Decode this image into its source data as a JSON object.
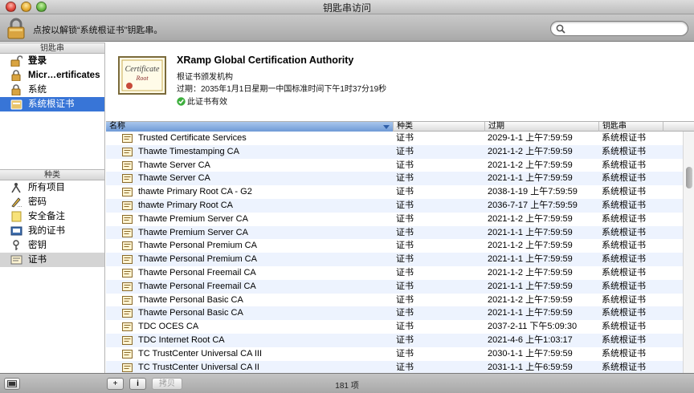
{
  "window": {
    "title": "钥匙串访问"
  },
  "toolbar": {
    "lock_hint": "点按以解锁“系统根证书”钥匙串。",
    "search": {
      "placeholder": "",
      "value": ""
    }
  },
  "sidebar": {
    "keychains_header": "钥匙串",
    "keychains": [
      {
        "label": "登录",
        "icon": "lock-open-icon",
        "bold": true
      },
      {
        "label": "Micr…ertificates",
        "icon": "lock-icon",
        "bold": true
      },
      {
        "label": "系统",
        "icon": "lock-icon",
        "bold": false
      },
      {
        "label": "系统根证书",
        "icon": "cabinet-icon",
        "bold": false,
        "selected": true
      }
    ],
    "category_header": "种类",
    "categories": [
      {
        "label": "所有项目",
        "icon": "all-items-icon"
      },
      {
        "label": "密码",
        "icon": "pencil-icon"
      },
      {
        "label": "安全备注",
        "icon": "note-icon"
      },
      {
        "label": "我的证书",
        "icon": "my-certificate-icon"
      },
      {
        "label": "密钥",
        "icon": "key-icon"
      },
      {
        "label": "证书",
        "icon": "certificate-icon",
        "selected": true
      }
    ]
  },
  "detail": {
    "name": "XRamp Global Certification Authority",
    "subtitle": "根证书颁发机构",
    "expiry": "过期：2035年1月1日星期一中国标准时间下午1时37分19秒",
    "valid": "此证书有效",
    "thumb_text": "Certificate",
    "thumb_root": "Root"
  },
  "table": {
    "columns": {
      "name": "名称",
      "kind": "种类",
      "expires": "过期",
      "keychain": "钥匙串"
    },
    "rows": [
      {
        "name": "Trusted Certificate Services",
        "kind": "证书",
        "expires": "2029-1-1 上午7:59:59",
        "keychain": "系统根证书"
      },
      {
        "name": "Thawte Timestamping CA",
        "kind": "证书",
        "expires": "2021-1-2 上午7:59:59",
        "keychain": "系统根证书"
      },
      {
        "name": "Thawte Server CA",
        "kind": "证书",
        "expires": "2021-1-2 上午7:59:59",
        "keychain": "系统根证书"
      },
      {
        "name": "Thawte Server CA",
        "kind": "证书",
        "expires": "2021-1-1 上午7:59:59",
        "keychain": "系统根证书"
      },
      {
        "name": "thawte Primary Root CA - G2",
        "kind": "证书",
        "expires": "2038-1-19 上午7:59:59",
        "keychain": "系统根证书"
      },
      {
        "name": "thawte Primary Root CA",
        "kind": "证书",
        "expires": "2036-7-17 上午7:59:59",
        "keychain": "系统根证书"
      },
      {
        "name": "Thawte Premium Server CA",
        "kind": "证书",
        "expires": "2021-1-2 上午7:59:59",
        "keychain": "系统根证书"
      },
      {
        "name": "Thawte Premium Server CA",
        "kind": "证书",
        "expires": "2021-1-1 上午7:59:59",
        "keychain": "系统根证书"
      },
      {
        "name": "Thawte Personal Premium CA",
        "kind": "证书",
        "expires": "2021-1-2 上午7:59:59",
        "keychain": "系统根证书"
      },
      {
        "name": "Thawte Personal Premium CA",
        "kind": "证书",
        "expires": "2021-1-1 上午7:59:59",
        "keychain": "系统根证书"
      },
      {
        "name": "Thawte Personal Freemail CA",
        "kind": "证书",
        "expires": "2021-1-2 上午7:59:59",
        "keychain": "系统根证书"
      },
      {
        "name": "Thawte Personal Freemail CA",
        "kind": "证书",
        "expires": "2021-1-1 上午7:59:59",
        "keychain": "系统根证书"
      },
      {
        "name": "Thawte Personal Basic CA",
        "kind": "证书",
        "expires": "2021-1-2 上午7:59:59",
        "keychain": "系统根证书"
      },
      {
        "name": "Thawte Personal Basic CA",
        "kind": "证书",
        "expires": "2021-1-1 上午7:59:59",
        "keychain": "系统根证书"
      },
      {
        "name": "TDC OCES CA",
        "kind": "证书",
        "expires": "2037-2-11 下午5:09:30",
        "keychain": "系统根证书"
      },
      {
        "name": "TDC Internet Root CA",
        "kind": "证书",
        "expires": "2021-4-6 上午1:03:17",
        "keychain": "系统根证书"
      },
      {
        "name": "TC TrustCenter Universal CA III",
        "kind": "证书",
        "expires": "2030-1-1 上午7:59:59",
        "keychain": "系统根证书"
      },
      {
        "name": "TC TrustCenter Universal CA II",
        "kind": "证书",
        "expires": "2031-1-1 上午6:59:59",
        "keychain": "系统根证书"
      }
    ]
  },
  "bottombar": {
    "add_label": "+",
    "info_label": "i",
    "copy_label": "拷贝",
    "item_count": "181 项"
  }
}
